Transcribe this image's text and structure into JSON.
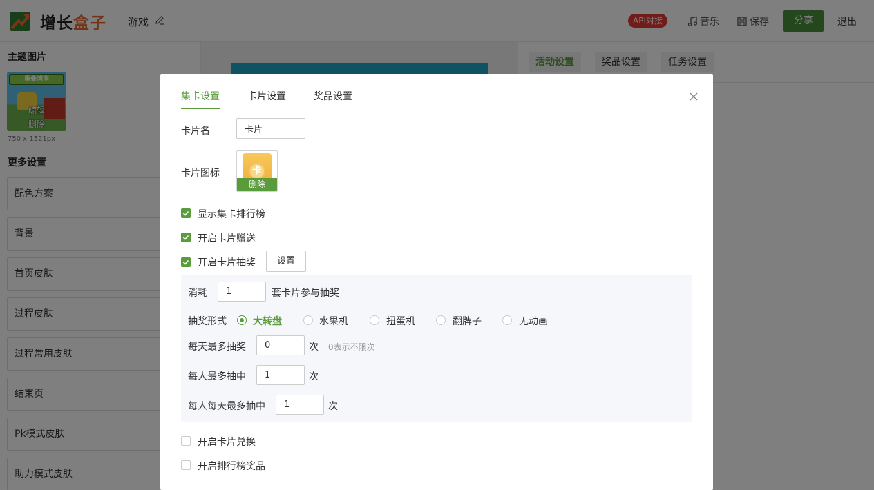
{
  "header": {
    "brand_part1": "增长",
    "brand_part2": "盒子",
    "project_title": "游戏",
    "api_badge": "API对接",
    "music_label": "音乐",
    "save_label": "保存",
    "share_label": "分享",
    "logout_label": "退出",
    "accent_color": "#4a8e3a"
  },
  "sidebar": {
    "theme_heading": "主题图片",
    "theme_image_text": "重叠消消",
    "edit_label": "编辑",
    "delete_label": "删除",
    "image_size": "750 x 1521px",
    "more_heading": "更多设置",
    "items": [
      "配色方案",
      "背景",
      "首页皮肤",
      "过程皮肤",
      "过程常用皮肤",
      "结束页",
      "Pk模式皮肤",
      "助力模式皮肤"
    ]
  },
  "right_panel": {
    "tabs": [
      "活动设置",
      "奖品设置",
      "任务设置"
    ],
    "active_tab": "活动设置"
  },
  "modal": {
    "tabs": [
      "集卡设置",
      "卡片设置",
      "奖品设置"
    ],
    "active_tab": "集卡设置",
    "card_name_label": "卡片名",
    "card_name_value": "卡片",
    "card_icon_label": "卡片图标",
    "card_icon_char": "卡",
    "icon_delete_label": "删除",
    "options": {
      "show_rank": {
        "label": "显示集卡排行榜",
        "checked": true
      },
      "enable_gift": {
        "label": "开启卡片赠送",
        "checked": true
      },
      "enable_lottery": {
        "label": "开启卡片抽奖",
        "checked": true
      },
      "enable_exchange": {
        "label": "开启卡片兑换",
        "checked": false
      },
      "enable_rank_prize": {
        "label": "开启排行榜奖品",
        "checked": false
      }
    },
    "lottery_settings_button": "设置",
    "lottery": {
      "consume_label": "消耗",
      "consume_value": "1",
      "consume_suffix": "套卡片参与抽奖",
      "form_label": "抽奖形式",
      "forms": [
        "大转盘",
        "水果机",
        "扭蛋机",
        "翻牌子",
        "无动画"
      ],
      "selected_form": "大转盘",
      "daily_max_label": "每天最多抽奖",
      "daily_max_value": "0",
      "times_unit": "次",
      "daily_max_hint": "0表示不限次",
      "per_user_max_label": "每人最多抽中",
      "per_user_max_value": "1",
      "per_user_daily_label": "每人每天最多抽中",
      "per_user_daily_value": "1"
    }
  }
}
